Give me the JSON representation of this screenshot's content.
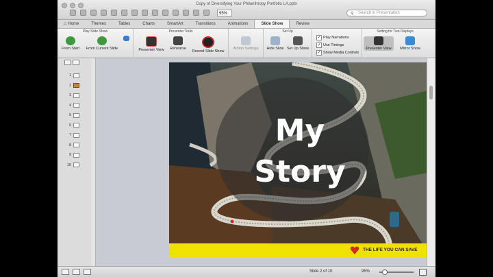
{
  "window": {
    "title": "Copy of Diversifying Your Philanthropy Portfolio LA.pptx",
    "zoom_box": "95%",
    "search_placeholder": "Search in Presentation"
  },
  "tabs": [
    {
      "label": "Home"
    },
    {
      "label": "Themes"
    },
    {
      "label": "Tables"
    },
    {
      "label": "Charts"
    },
    {
      "label": "SmartArt"
    },
    {
      "label": "Transitions"
    },
    {
      "label": "Animations"
    },
    {
      "label": "Slide Show"
    },
    {
      "label": "Review"
    }
  ],
  "ribbon": {
    "play_group": "Play Slide Show",
    "from_start": "From Start",
    "from_current": "From Current Slide",
    "presenter_group": "Presenter Tools",
    "presenter_view": "Presenter View",
    "rehearse": "Rehearse",
    "record": "Record Slide Show",
    "action_settings": "Action Settings",
    "setup_group": "Set Up",
    "hide_slide": "Hide Slide",
    "set_up_show": "Set Up Show",
    "play_narrations": "Play Narrations",
    "use_timings": "Use Timings",
    "show_media_controls": "Show Media Controls",
    "two_displays_group": "Setting for Two Displays",
    "presenter_view_2": "Presenter View",
    "mirror_show": "Mirror Show"
  },
  "slides": [
    {
      "num": "1"
    },
    {
      "num": "2"
    },
    {
      "num": "3"
    },
    {
      "num": "4"
    },
    {
      "num": "5"
    },
    {
      "num": "6"
    },
    {
      "num": "7"
    },
    {
      "num": "8"
    },
    {
      "num": "9"
    },
    {
      "num": "10"
    }
  ],
  "slide": {
    "title_line1": "My",
    "title_line2": "Story",
    "tagline": "THE LIFE YOU CAN SAVE"
  },
  "status": {
    "slide_indicator": "Slide 2 of 10",
    "zoom": "95%"
  }
}
